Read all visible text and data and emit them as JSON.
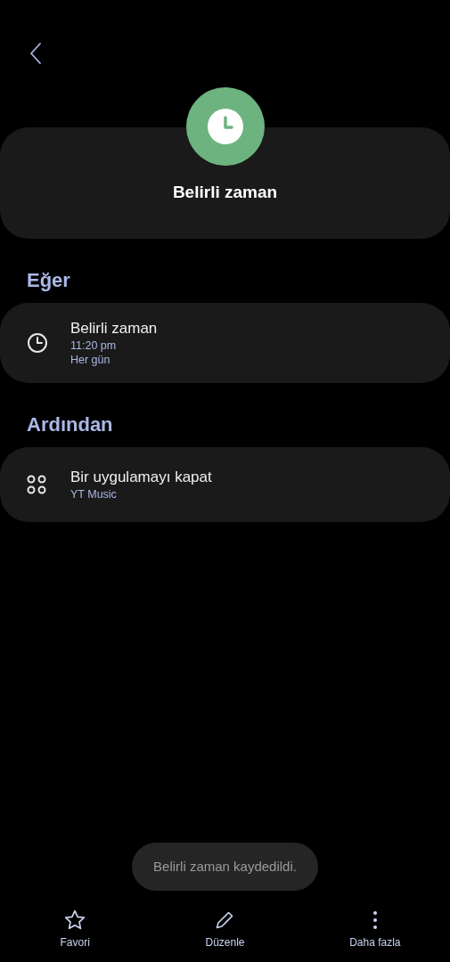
{
  "header": {
    "title": "Belirli zaman"
  },
  "sections": [
    {
      "heading": "Eğer",
      "items": [
        {
          "kind": "clock",
          "title": "Belirli zaman",
          "details": [
            "11:20 pm",
            "Her gün"
          ]
        }
      ]
    },
    {
      "heading": "Ardından",
      "items": [
        {
          "kind": "apps",
          "title": "Bir uygulamayı kapat",
          "details": [
            "YT Music"
          ]
        }
      ]
    }
  ],
  "toast": "Belirli zaman kaydedildi.",
  "bottom_bar": [
    {
      "kind": "star",
      "label": "Favori"
    },
    {
      "kind": "pencil",
      "label": "Düzenle"
    },
    {
      "kind": "more",
      "label": "Daha fazla"
    }
  ]
}
